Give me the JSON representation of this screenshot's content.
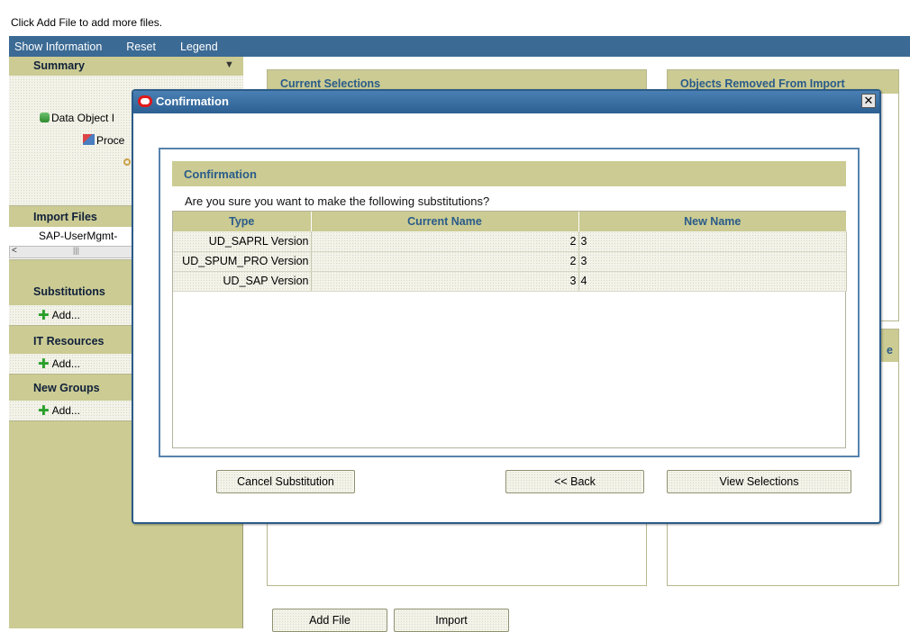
{
  "hint": "Click Add File to add more files.",
  "menubar": {
    "items": [
      "Show Information",
      "Reset",
      "Legend"
    ]
  },
  "sidebar": {
    "summary_title": "Summary",
    "summary_items": [
      "Data Object I",
      "Proce"
    ],
    "import_files_title": "Import Files",
    "import_file": "SAP-UserMgmt-",
    "substitutions_title": "Substitutions",
    "substitutions_add": "Add...",
    "it_resources_title": "IT Resources",
    "it_resources_add": "Add...",
    "new_groups_title": "New Groups",
    "new_groups_add": "Add..."
  },
  "background": {
    "current_selections_title": "Current Selections",
    "objects_removed_title": "Objects Removed From Import",
    "partial_label": "e",
    "add_file_button": "Add File",
    "import_button": "Import"
  },
  "modal": {
    "title": "Confirmation",
    "close_glyph": "✕",
    "section_title": "Confirmation",
    "question": "Are you sure you want to make the following substitutions?",
    "columns": [
      "Type",
      "Current Name",
      "New Name"
    ],
    "rows": [
      {
        "type": "UD_SAPRL Version",
        "current": "2",
        "new": "3"
      },
      {
        "type": "UD_SPUM_PRO Version",
        "current": "2",
        "new": "3"
      },
      {
        "type": "UD_SAP Version",
        "current": "3",
        "new": "4"
      }
    ],
    "cancel_button": "Cancel Substitution",
    "back_button": "<< Back",
    "view_button": "View Selections"
  },
  "colors": {
    "menubar": "#3b6a94",
    "panel": "#cbcb93",
    "header_text": "#2a5b8a",
    "modal_border": "#2b5b88"
  }
}
